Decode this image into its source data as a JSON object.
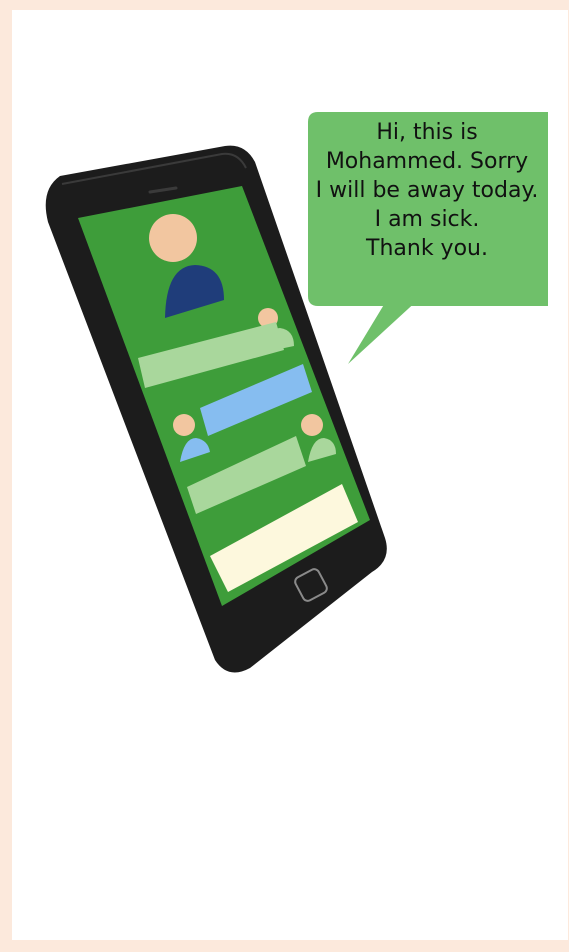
{
  "speech_bubble": {
    "lines": [
      "Hi, this is",
      "Mohammed. Sorry",
      "I will be away today.",
      "I am sick.",
      "Thank you."
    ]
  },
  "colors": {
    "page_background": "#fce9dc",
    "panel_background": "#ffffff",
    "phone_body": "#1c1c1c",
    "screen": "#3e9d3a",
    "bubble": "#6fc06a",
    "message_green": "#a9d79c",
    "message_blue": "#86bdf0",
    "input_box": "#fdf8dd",
    "avatar_face": "#f2c6a0",
    "avatar_body_navy": "#1f3d7a"
  },
  "icons": {
    "home_button": "home-button-icon",
    "contact_avatar": "user-avatar-icon"
  }
}
